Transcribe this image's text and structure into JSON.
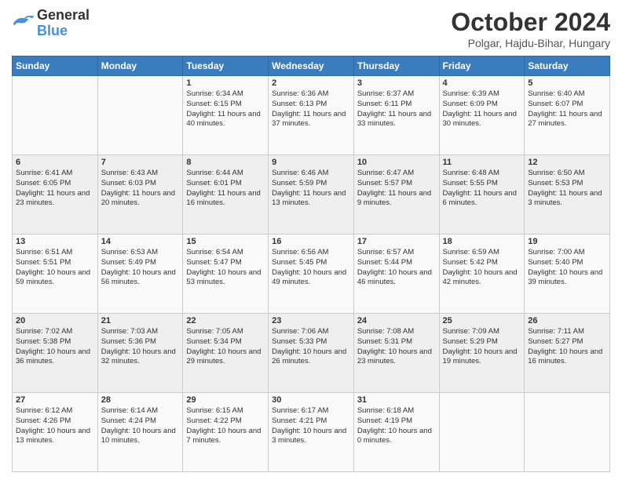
{
  "logo": {
    "line1": "General",
    "line2": "Blue"
  },
  "title": "October 2024",
  "subtitle": "Polgar, Hajdu-Bihar, Hungary",
  "header_days": [
    "Sunday",
    "Monday",
    "Tuesday",
    "Wednesday",
    "Thursday",
    "Friday",
    "Saturday"
  ],
  "weeks": [
    [
      {
        "day": "",
        "info": ""
      },
      {
        "day": "",
        "info": ""
      },
      {
        "day": "1",
        "info": "Sunrise: 6:34 AM\nSunset: 6:15 PM\nDaylight: 11 hours and 40 minutes."
      },
      {
        "day": "2",
        "info": "Sunrise: 6:36 AM\nSunset: 6:13 PM\nDaylight: 11 hours and 37 minutes."
      },
      {
        "day": "3",
        "info": "Sunrise: 6:37 AM\nSunset: 6:11 PM\nDaylight: 11 hours and 33 minutes."
      },
      {
        "day": "4",
        "info": "Sunrise: 6:39 AM\nSunset: 6:09 PM\nDaylight: 11 hours and 30 minutes."
      },
      {
        "day": "5",
        "info": "Sunrise: 6:40 AM\nSunset: 6:07 PM\nDaylight: 11 hours and 27 minutes."
      }
    ],
    [
      {
        "day": "6",
        "info": "Sunrise: 6:41 AM\nSunset: 6:05 PM\nDaylight: 11 hours and 23 minutes."
      },
      {
        "day": "7",
        "info": "Sunrise: 6:43 AM\nSunset: 6:03 PM\nDaylight: 11 hours and 20 minutes."
      },
      {
        "day": "8",
        "info": "Sunrise: 6:44 AM\nSunset: 6:01 PM\nDaylight: 11 hours and 16 minutes."
      },
      {
        "day": "9",
        "info": "Sunrise: 6:46 AM\nSunset: 5:59 PM\nDaylight: 11 hours and 13 minutes."
      },
      {
        "day": "10",
        "info": "Sunrise: 6:47 AM\nSunset: 5:57 PM\nDaylight: 11 hours and 9 minutes."
      },
      {
        "day": "11",
        "info": "Sunrise: 6:48 AM\nSunset: 5:55 PM\nDaylight: 11 hours and 6 minutes."
      },
      {
        "day": "12",
        "info": "Sunrise: 6:50 AM\nSunset: 5:53 PM\nDaylight: 11 hours and 3 minutes."
      }
    ],
    [
      {
        "day": "13",
        "info": "Sunrise: 6:51 AM\nSunset: 5:51 PM\nDaylight: 10 hours and 59 minutes."
      },
      {
        "day": "14",
        "info": "Sunrise: 6:53 AM\nSunset: 5:49 PM\nDaylight: 10 hours and 56 minutes."
      },
      {
        "day": "15",
        "info": "Sunrise: 6:54 AM\nSunset: 5:47 PM\nDaylight: 10 hours and 53 minutes."
      },
      {
        "day": "16",
        "info": "Sunrise: 6:56 AM\nSunset: 5:45 PM\nDaylight: 10 hours and 49 minutes."
      },
      {
        "day": "17",
        "info": "Sunrise: 6:57 AM\nSunset: 5:44 PM\nDaylight: 10 hours and 46 minutes."
      },
      {
        "day": "18",
        "info": "Sunrise: 6:59 AM\nSunset: 5:42 PM\nDaylight: 10 hours and 42 minutes."
      },
      {
        "day": "19",
        "info": "Sunrise: 7:00 AM\nSunset: 5:40 PM\nDaylight: 10 hours and 39 minutes."
      }
    ],
    [
      {
        "day": "20",
        "info": "Sunrise: 7:02 AM\nSunset: 5:38 PM\nDaylight: 10 hours and 36 minutes."
      },
      {
        "day": "21",
        "info": "Sunrise: 7:03 AM\nSunset: 5:36 PM\nDaylight: 10 hours and 32 minutes."
      },
      {
        "day": "22",
        "info": "Sunrise: 7:05 AM\nSunset: 5:34 PM\nDaylight: 10 hours and 29 minutes."
      },
      {
        "day": "23",
        "info": "Sunrise: 7:06 AM\nSunset: 5:33 PM\nDaylight: 10 hours and 26 minutes."
      },
      {
        "day": "24",
        "info": "Sunrise: 7:08 AM\nSunset: 5:31 PM\nDaylight: 10 hours and 23 minutes."
      },
      {
        "day": "25",
        "info": "Sunrise: 7:09 AM\nSunset: 5:29 PM\nDaylight: 10 hours and 19 minutes."
      },
      {
        "day": "26",
        "info": "Sunrise: 7:11 AM\nSunset: 5:27 PM\nDaylight: 10 hours and 16 minutes."
      }
    ],
    [
      {
        "day": "27",
        "info": "Sunrise: 6:12 AM\nSunset: 4:26 PM\nDaylight: 10 hours and 13 minutes."
      },
      {
        "day": "28",
        "info": "Sunrise: 6:14 AM\nSunset: 4:24 PM\nDaylight: 10 hours and 10 minutes."
      },
      {
        "day": "29",
        "info": "Sunrise: 6:15 AM\nSunset: 4:22 PM\nDaylight: 10 hours and 7 minutes."
      },
      {
        "day": "30",
        "info": "Sunrise: 6:17 AM\nSunset: 4:21 PM\nDaylight: 10 hours and 3 minutes."
      },
      {
        "day": "31",
        "info": "Sunrise: 6:18 AM\nSunset: 4:19 PM\nDaylight: 10 hours and 0 minutes."
      },
      {
        "day": "",
        "info": ""
      },
      {
        "day": "",
        "info": ""
      }
    ]
  ]
}
